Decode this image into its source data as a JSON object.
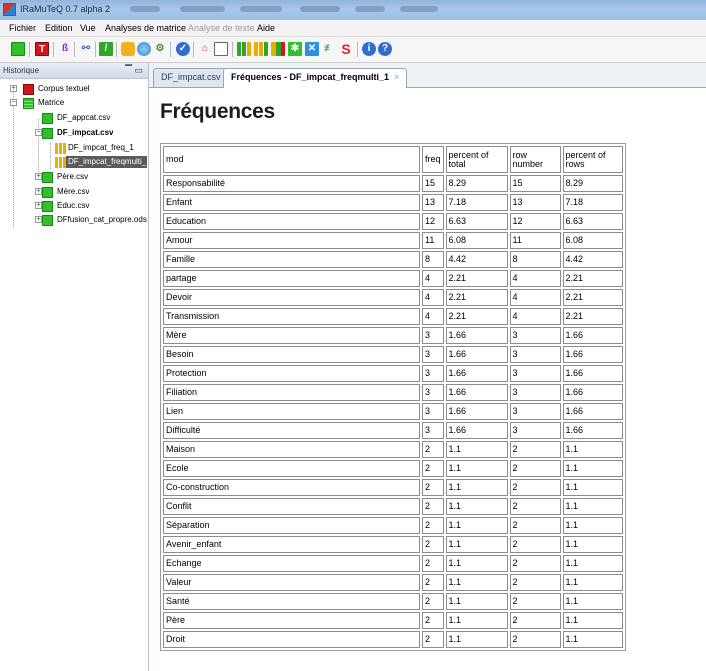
{
  "window": {
    "title": "IRaMuTeQ 0.7 alpha 2"
  },
  "menu": {
    "items": [
      "Fichier",
      "Edition",
      "Vue",
      "Analyses de matrice"
    ],
    "disabled_item": "Analyse de texte",
    "help": "Aide"
  },
  "toolbar": {
    "icons": [
      "matrix-icon",
      "text-corpus-icon",
      "spec-icon",
      "link-icon",
      "ruler-icon",
      "folder-icon",
      "chart-icon",
      "preferences-icon",
      "check-icon",
      "home-icon",
      "list-icon",
      "frequency-icon",
      "chi2-icon",
      "tree-icon",
      "afc-icon",
      "similarity-icon",
      "cross-icon",
      "stats-icon",
      "info-icon",
      "help-icon"
    ]
  },
  "sidebar": {
    "title": "Historique",
    "tree": {
      "corpus": "Corpus textuel",
      "matrix": "Matrice",
      "items": [
        {
          "label": "DF_appcat.csv"
        },
        {
          "label": "DF_impcat.csv",
          "bold": true,
          "children": [
            "DF_impcat_freq_1",
            "DF_impcat_freqmulti_1"
          ]
        },
        {
          "label": "Père.csv"
        },
        {
          "label": "Mère.csv"
        },
        {
          "label": "Educ.csv"
        },
        {
          "label": "DFfusion_cat_propre.ods"
        }
      ]
    }
  },
  "tabs": [
    {
      "label": "DF_impcat.csv",
      "active": false
    },
    {
      "label": "Fréquences - DF_impcat_freqmulti_1",
      "active": true,
      "close": "×"
    }
  ],
  "content": {
    "heading": "Fréquences",
    "table": {
      "headers": [
        "mod",
        "freq",
        "percent of total",
        "row number",
        "percent of rows"
      ],
      "rows": [
        [
          "Responsabilité",
          "15",
          "8.29",
          "15",
          "8.29"
        ],
        [
          "Enfant",
          "13",
          "7.18",
          "13",
          "7.18"
        ],
        [
          "Education",
          "12",
          "6.63",
          "12",
          "6.63"
        ],
        [
          "Amour",
          "11",
          "6.08",
          "11",
          "6.08"
        ],
        [
          "Famille",
          "8",
          "4.42",
          "8",
          "4.42"
        ],
        [
          "partage",
          "4",
          "2.21",
          "4",
          "2.21"
        ],
        [
          "Devoir",
          "4",
          "2.21",
          "4",
          "2.21"
        ],
        [
          "Transmission",
          "4",
          "2.21",
          "4",
          "2.21"
        ],
        [
          "Mère",
          "3",
          "1.66",
          "3",
          "1.66"
        ],
        [
          "Besoin",
          "3",
          "1.66",
          "3",
          "1.66"
        ],
        [
          "Protection",
          "3",
          "1.66",
          "3",
          "1.66"
        ],
        [
          "Filiation",
          "3",
          "1.66",
          "3",
          "1.66"
        ],
        [
          "Lien",
          "3",
          "1.66",
          "3",
          "1.66"
        ],
        [
          "Difficulté",
          "3",
          "1.66",
          "3",
          "1.66"
        ],
        [
          "Maison",
          "2",
          "1.1",
          "2",
          "1.1"
        ],
        [
          "Ecole",
          "2",
          "1.1",
          "2",
          "1.1"
        ],
        [
          "Co-construction",
          "2",
          "1.1",
          "2",
          "1.1"
        ],
        [
          "Conflit",
          "2",
          "1.1",
          "2",
          "1.1"
        ],
        [
          "Séparation",
          "2",
          "1.1",
          "2",
          "1.1"
        ],
        [
          "Avenir_enfant",
          "2",
          "1.1",
          "2",
          "1.1"
        ],
        [
          "Echange",
          "2",
          "1.1",
          "2",
          "1.1"
        ],
        [
          "Valeur",
          "2",
          "1.1",
          "2",
          "1.1"
        ],
        [
          "Santé",
          "2",
          "1.1",
          "2",
          "1.1"
        ],
        [
          "Père",
          "2",
          "1.1",
          "2",
          "1.1"
        ],
        [
          "Droit",
          "2",
          "1.1",
          "2",
          "1.1"
        ]
      ]
    }
  }
}
